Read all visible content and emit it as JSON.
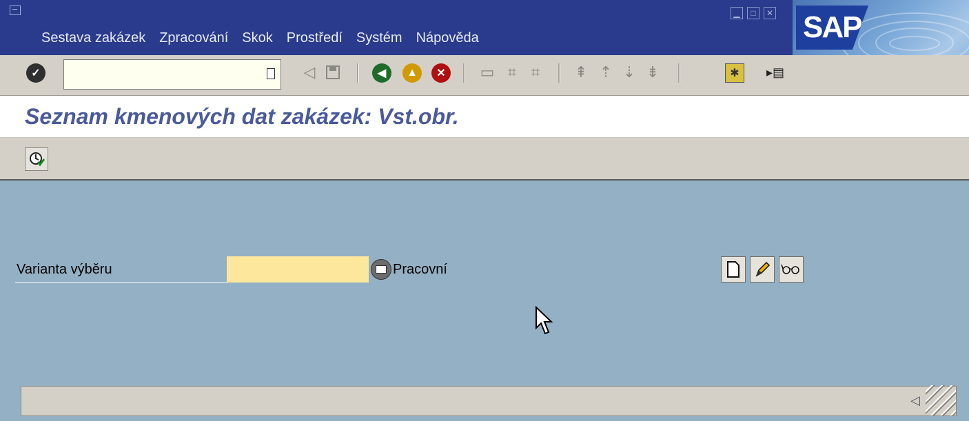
{
  "menu": {
    "items": [
      {
        "label": "Sestava zakázek"
      },
      {
        "label": "Zpracování"
      },
      {
        "label": "Skok"
      },
      {
        "label": "Prostředí"
      },
      {
        "label": "Systém"
      },
      {
        "label": "Nápověda"
      }
    ]
  },
  "brand": {
    "logo_text": "SAP"
  },
  "toolbar": {
    "command_field_value": "",
    "icons": [
      "enter-icon",
      "back-icon",
      "save-icon",
      "back-green-icon",
      "exit-icon",
      "cancel-icon",
      "print-icon",
      "find-icon",
      "find-next-icon",
      "first-page-icon",
      "previous-page-icon",
      "next-page-icon",
      "last-page-icon",
      "create-session-icon",
      "generate-shortcut-icon"
    ]
  },
  "screen": {
    "title": "Seznam kmenových dat zakázek: Vst.obr."
  },
  "selection": {
    "label": "Varianta výběru",
    "value": "",
    "description": "Pracovní"
  },
  "colors": {
    "title_bar": "#2a3a8c",
    "toolbar_bg": "#d4d0c8",
    "content_bg": "#94b0c4",
    "input_bg": "#fde79c",
    "title_text": "#4a5a9a"
  }
}
